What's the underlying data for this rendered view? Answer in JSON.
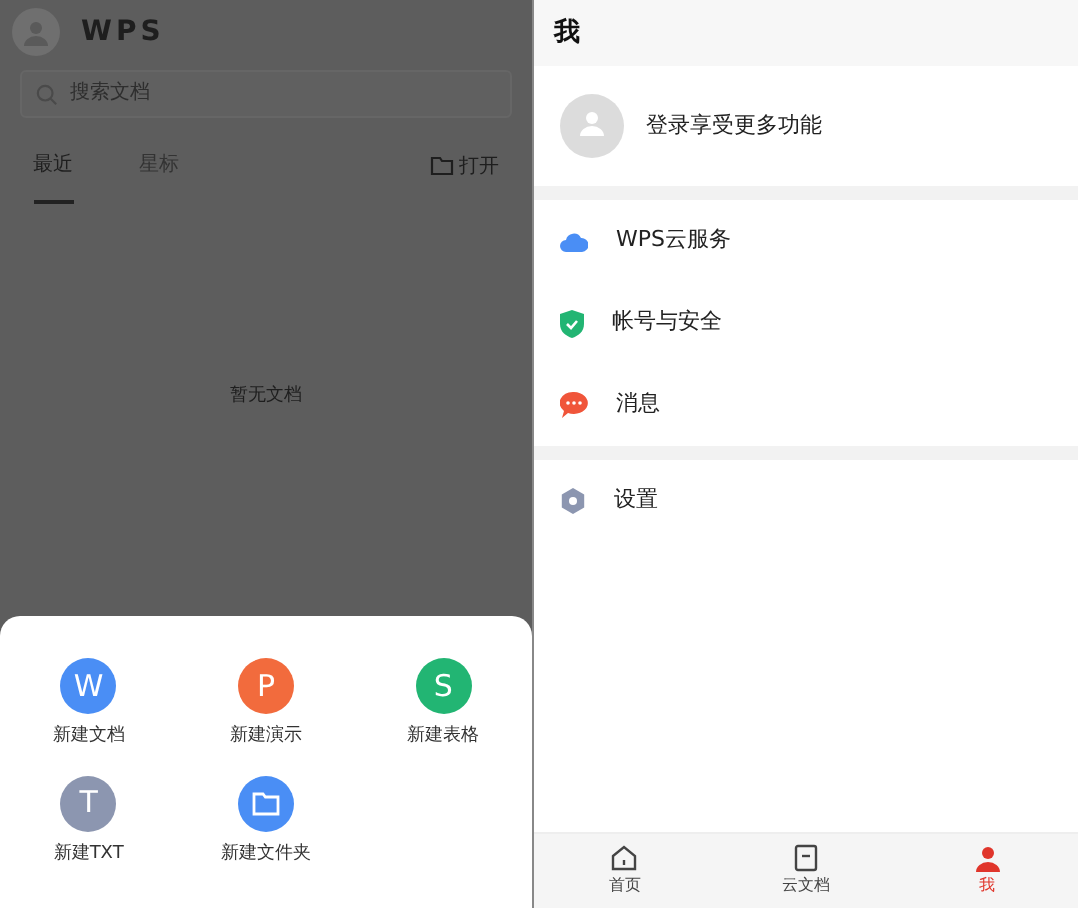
{
  "home": {
    "logo": "WPS",
    "search": {
      "placeholder": "搜索文档"
    },
    "tabs": [
      {
        "label": "最近",
        "selected": true
      },
      {
        "label": "星标",
        "selected": false
      }
    ],
    "open_button": "打开",
    "empty_text": "暂无文档"
  },
  "create_sheet": {
    "items": [
      {
        "kind": "doc",
        "icon_text": "W",
        "label": "新建文档",
        "color": "#4a8ef5"
      },
      {
        "kind": "ppt",
        "icon_text": "P",
        "label": "新建演示",
        "color": "#f26b3d"
      },
      {
        "kind": "sheet",
        "icon_text": "S",
        "label": "新建表格",
        "color": "#22b573"
      },
      {
        "kind": "txt",
        "icon_text": "T",
        "label": "新建TXT",
        "color": "#8c96b0"
      },
      {
        "kind": "folder",
        "label": "新建文件夹",
        "color": "#4a8ef5"
      }
    ]
  },
  "profile": {
    "title": "我",
    "login_text": "登录享受更多功能",
    "menu": [
      {
        "kind": "cloud",
        "label": "WPS云服务"
      },
      {
        "kind": "shield",
        "label": "帐号与安全"
      },
      {
        "kind": "message",
        "label": "消息"
      },
      {
        "kind": "gear",
        "label": "设置",
        "group_start": true
      }
    ]
  },
  "bottom_nav": [
    {
      "kind": "home",
      "label": "首页",
      "selected": false
    },
    {
      "kind": "cloud-doc",
      "label": "云文档",
      "selected": false
    },
    {
      "kind": "me",
      "label": "我",
      "selected": true
    }
  ]
}
